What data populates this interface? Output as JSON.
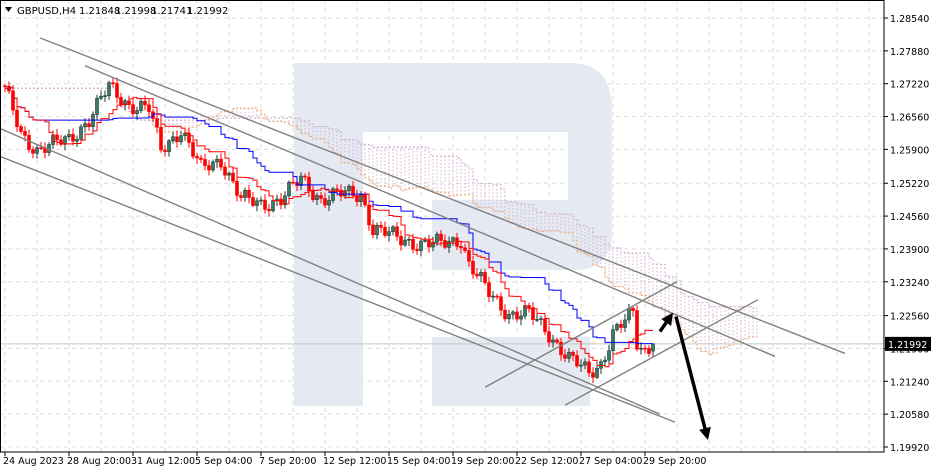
{
  "header": {
    "symbol_timeframe": "GBPUSD,H4",
    "open": "1.21848",
    "high": "1.21998",
    "low": "1.21741",
    "close": "1.21992"
  },
  "colors": {
    "bull": "#3b7a66",
    "bull_outline": "#1b3a30",
    "bear": "#ff0000",
    "tenkan": "#ff0000",
    "kijun": "#0000ff",
    "span_a": "#f0a060",
    "span_b": "#c9a3c9",
    "trendline": "#808080",
    "arrow": "#000000",
    "watermark": "#e5eaf2"
  },
  "chart_data": {
    "type": "candlestick",
    "title": "GBPUSD,H4",
    "indicator": "Ichimoku Kinko Hyo (9, 26, 52)",
    "ylim": [
      1.1992,
      1.2854
    ],
    "current_price": "1.21992",
    "price_ticks": [
      "1.28540",
      "1.27880",
      "1.27220",
      "1.26560",
      "1.25900",
      "1.25220",
      "1.24560",
      "1.23900",
      "1.23240",
      "1.22560",
      "1.21900",
      "1.21240",
      "1.20580",
      "1.19920"
    ],
    "date_labels": [
      "24 Aug 2023",
      "28 Aug 20:00",
      "31 Aug 12:00",
      "5 Sep 04:00",
      "7 Sep 20:00",
      "12 Sep 12:00",
      "15 Sep 04:00",
      "19 Sep 20:00",
      "22 Sep 12:00",
      "27 Sep 04:00",
      "29 Sep 20:00"
    ],
    "bars_between_date_labels": 16,
    "bar_count": 163,
    "close_path": [
      [
        0,
        1.271
      ],
      [
        4,
        1.262
      ],
      [
        8,
        1.259
      ],
      [
        16,
        1.261
      ],
      [
        21,
        1.265
      ],
      [
        26,
        1.2715
      ],
      [
        31,
        1.268
      ],
      [
        36,
        1.267
      ],
      [
        39,
        1.259
      ],
      [
        44,
        1.263
      ],
      [
        49,
        1.255
      ],
      [
        54,
        1.257
      ],
      [
        59,
        1.249
      ],
      [
        64,
        1.248
      ],
      [
        69,
        1.249
      ],
      [
        74,
        1.253
      ],
      [
        79,
        1.249
      ],
      [
        84,
        1.25
      ],
      [
        89,
        1.25
      ],
      [
        92,
        1.243
      ],
      [
        99,
        1.241
      ],
      [
        104,
        1.24
      ],
      [
        109,
        1.24
      ],
      [
        114,
        1.241
      ],
      [
        116,
        1.236
      ],
      [
        121,
        1.23
      ],
      [
        126,
        1.226
      ],
      [
        131,
        1.226
      ],
      [
        136,
        1.222
      ],
      [
        141,
        1.217
      ],
      [
        146,
        1.214
      ],
      [
        149,
        1.216
      ],
      [
        152,
        1.222
      ],
      [
        157,
        1.226
      ],
      [
        158,
        1.22
      ],
      [
        160,
        1.2185
      ],
      [
        162,
        1.2199
      ]
    ],
    "last_bar": {
      "open": 1.21848,
      "high": 1.21998,
      "low": 1.21741,
      "close": 1.21992
    },
    "trendlines": [
      [
        [
          8.75,
          1.2814
        ],
        [
          210,
          1.218
        ]
      ],
      [
        [
          20,
          1.2758
        ],
        [
          192.5,
          1.2174
        ]
      ],
      [
        [
          -1.25,
          1.2632
        ],
        [
          163.75,
          1.2058
        ]
      ],
      [
        [
          -1.25,
          1.2576
        ],
        [
          167.5,
          1.2042
        ]
      ],
      [
        [
          120,
          1.2112
        ],
        [
          168,
          1.2324
        ]
      ],
      [
        [
          140,
          1.2076
        ],
        [
          188.25,
          1.2288
        ]
      ]
    ],
    "arrows": [
      [
        [
          163.75,
          1.2224
        ],
        [
          167,
          1.2262
        ]
      ],
      [
        [
          167.75,
          1.2254
        ],
        [
          175.75,
          1.2006
        ]
      ]
    ]
  }
}
